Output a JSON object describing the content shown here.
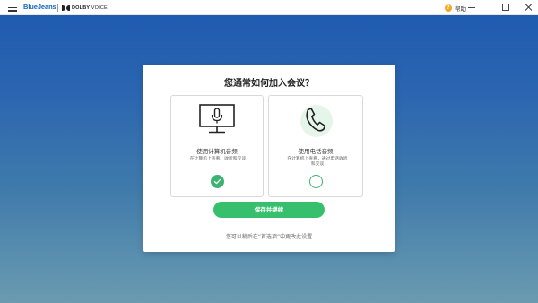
{
  "titlebar": {
    "brand": "BlueJeans",
    "partner_brand_strong": "DOLBY",
    "partner_brand_light": "VOICE",
    "help_label": "帮助",
    "menu_icon": "hamburger-menu-icon",
    "window_controls": [
      "minimize-icon",
      "maximize-icon",
      "close-icon"
    ]
  },
  "dialog": {
    "title": "您通常如何加入会议？",
    "options": [
      {
        "label": "使用计算机音频",
        "description": "在计算机上查看、收听和交谈",
        "icon": "computer-microphone-icon",
        "selected": true
      },
      {
        "label": "使用电话音频",
        "description": "在计算机上查看，通过电话收听和交谈",
        "icon": "phone-icon",
        "selected": false
      }
    ],
    "save_button": "保存并继续",
    "footnote": "您可以稍后在“首选项”中更改此设置"
  },
  "colors": {
    "accent_green": "#36c06e",
    "brand_blue": "#1565c0",
    "background_top": "#1f5bb0",
    "background_bottom": "#6a9bb0"
  }
}
